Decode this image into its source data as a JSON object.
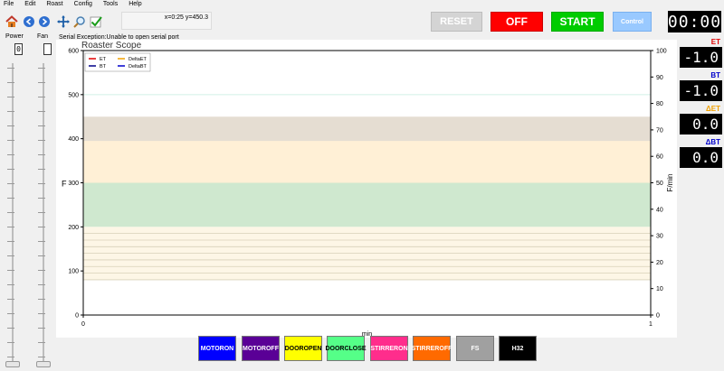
{
  "menu": [
    "File",
    "Edit",
    "Roast",
    "Config",
    "Tools",
    "Help"
  ],
  "toolbar": {
    "coords": "x=0:25 y=450.3",
    "reset_label": "RESET",
    "off_label": "OFF",
    "start_label": "START",
    "control_label": "Control",
    "timer": "00:00"
  },
  "sliders": {
    "power_label": "Power",
    "fan_label": "Fan",
    "power_value": "0",
    "fan_value": ""
  },
  "serial_message": "Serial Exception:Unable to open serial port",
  "lcds": [
    {
      "label": "ET",
      "value": "-1.0",
      "color": "#e00000"
    },
    {
      "label": "BT",
      "value": "-1.0",
      "color": "#0000cc"
    },
    {
      "label": "ΔET",
      "value": "0.0",
      "color": "#f0a000"
    },
    {
      "label": "ΔBT",
      "value": "0.0",
      "color": "#0000cc"
    }
  ],
  "bottom_buttons": [
    {
      "label1": "MOTOR",
      "label2": "ON",
      "bg": "#0000ff",
      "fg": "#ffffff"
    },
    {
      "label1": "MOTOR",
      "label2": "OFF",
      "bg": "#5a0096",
      "fg": "#ffffff"
    },
    {
      "label1": "DOOR",
      "label2": "OPEN",
      "bg": "#ffff00",
      "fg": "#000000"
    },
    {
      "label1": "DOOR",
      "label2": "CLOSE",
      "bg": "#55ff88",
      "fg": "#000000"
    },
    {
      "label1": "STIRRER",
      "label2": "ON",
      "bg": "#ff2d8c",
      "fg": "#ffffff"
    },
    {
      "label1": "STIRRER",
      "label2": "OFF",
      "bg": "#ff6a00",
      "fg": "#ffffff"
    },
    {
      "label1": "FS",
      "label2": "",
      "bg": "#a0a0a0",
      "fg": "#ffffff"
    },
    {
      "label1": "H32",
      "label2": "",
      "bg": "#000000",
      "fg": "#ffffff"
    }
  ],
  "chart_data": {
    "type": "line",
    "title": "Roaster Scope",
    "xlabel": "min",
    "ylabel": "F",
    "y2label": "F/min",
    "xlim": [
      0,
      1
    ],
    "ylim": [
      0,
      600
    ],
    "y2lim": [
      0,
      100
    ],
    "xticks": [
      "0",
      "1"
    ],
    "yticks": [
      "0",
      "100",
      "200",
      "300",
      "400",
      "500",
      "600"
    ],
    "y2ticks": [
      "0",
      "10",
      "20",
      "30",
      "40",
      "50",
      "60",
      "70",
      "80",
      "90",
      "100"
    ],
    "legend": [
      "ET",
      "BT",
      "DeltaET",
      "DeltaBT"
    ],
    "legend_position": "top-left",
    "series": [
      {
        "name": "ET",
        "color": "#e00000",
        "values": []
      },
      {
        "name": "BT",
        "color": "#000088",
        "values": []
      },
      {
        "name": "DeltaET",
        "color": "#f0a000",
        "values": []
      },
      {
        "name": "DeltaBT",
        "color": "#0000cc",
        "values": []
      }
    ],
    "bands": [
      {
        "from": 360,
        "to": 450,
        "color": "#e5ddd2"
      },
      {
        "from": 300,
        "to": 395,
        "color": "#fff0d6"
      },
      {
        "from": 200,
        "to": 300,
        "color": "#cfe8cf"
      },
      {
        "from": 80,
        "to": 200,
        "color": "#fdf6e6"
      }
    ]
  }
}
